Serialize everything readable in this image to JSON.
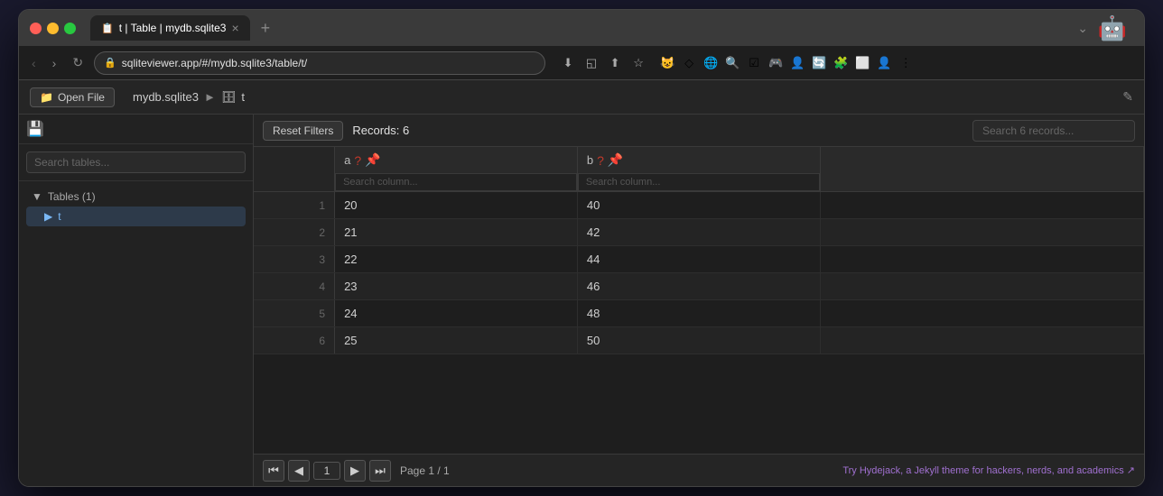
{
  "browser": {
    "tab_title": "t | Table | mydb.sqlite3",
    "url": "sqliteviewer.app/#/mydb.sqlite3/table/t/",
    "new_tab_label": "+",
    "tab_close": "×"
  },
  "app_header": {
    "open_file_label": "Open File",
    "breadcrumb_db": "mydb.sqlite3",
    "breadcrumb_sep": "►",
    "breadcrumb_table": "t"
  },
  "sidebar": {
    "search_placeholder": "Search tables...",
    "section_label": "Tables (1)",
    "table_item": "t"
  },
  "toolbar": {
    "reset_filters_label": "Reset Filters",
    "records_label": "Records: 6",
    "search_placeholder": "Search 6 records..."
  },
  "table": {
    "columns": [
      {
        "key": "a",
        "label": "a",
        "search_placeholder": "Search column..."
      },
      {
        "key": "b",
        "label": "b",
        "search_placeholder": "Search column..."
      }
    ],
    "rows": [
      {
        "row_num": "1",
        "a": "20",
        "b": "40"
      },
      {
        "row_num": "2",
        "a": "21",
        "b": "42"
      },
      {
        "row_num": "3",
        "a": "22",
        "b": "44"
      },
      {
        "row_num": "4",
        "a": "23",
        "b": "46"
      },
      {
        "row_num": "5",
        "a": "24",
        "b": "48"
      },
      {
        "row_num": "6",
        "a": "25",
        "b": "50"
      }
    ]
  },
  "pagination": {
    "current_page": "1",
    "page_info": "Page 1 / 1",
    "first_label": "⏮",
    "prev_label": "◀",
    "next_label": "▶",
    "last_label": "⏭"
  },
  "footer": {
    "hydejack_text": "Try Hydejack, a Jekyll theme for hackers, nerds, and academics ↗"
  },
  "colors": {
    "accent": "#a070d0",
    "col_icon": "#c0392b",
    "link": "#a070d0"
  }
}
